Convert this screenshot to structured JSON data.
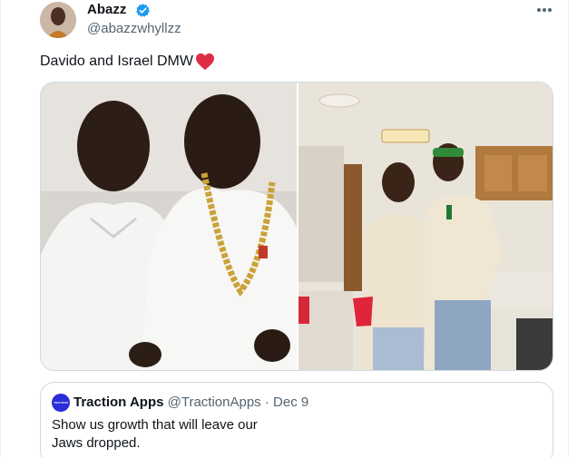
{
  "tweet": {
    "author": {
      "display_name": "Abazz",
      "handle": "@abazzwhyllzz",
      "verified": true,
      "verified_color": "#1d9bf0"
    },
    "more_icon": "more-horizontal-icon",
    "text": "Davido and Israel DMW",
    "text_emoji": "red-heart-icon",
    "media": [
      {
        "alt": "two men in white shirts"
      },
      {
        "alt": "two men standing in a kitchen"
      }
    ]
  },
  "quote": {
    "brand_mark": "TRACTION",
    "name": "Traction Apps",
    "handle": "@TractionApps",
    "separator": "·",
    "date": "Dec 9",
    "text_line1": "Show us growth that will leave our",
    "text_line2": "Jaws dropped.",
    "avatar_color": "#2b2ed6"
  }
}
